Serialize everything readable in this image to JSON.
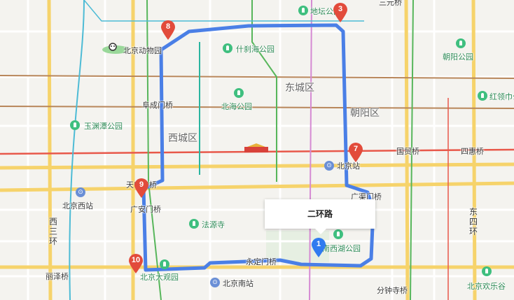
{
  "route": {
    "popup_label": "二环路",
    "color": "#4a7fe6"
  },
  "pins": [
    {
      "id": "1",
      "color": "#2f7bf0"
    },
    {
      "id": "3",
      "color": "#e24b3b"
    },
    {
      "id": "7",
      "color": "#e24b3b"
    },
    {
      "id": "8",
      "color": "#e24b3b"
    },
    {
      "id": "9",
      "color": "#e24b3b"
    },
    {
      "id": "10",
      "color": "#e24b3b"
    }
  ],
  "districts": {
    "dongcheng": "东城区",
    "xicheng": "西城区",
    "chaoyang": "朝阳区"
  },
  "pois": {
    "ditan": "地坛公园",
    "zoo": "北京动物园",
    "shichahai": "什刹海公园",
    "chaoyang_park": "朝阳公园",
    "beihai": "北海公园",
    "hongling": "红领巾公",
    "yuyuantan": "玉渊潭公园",
    "fayuan": "法源寺",
    "nanhu": "南西湖公园",
    "daguanyuan": "北京大观园",
    "huanlegu": "北京欢乐谷"
  },
  "places": {
    "fuchengmen": "阜成门桥",
    "guomao": "国贸桥",
    "sihui": "四惠桥",
    "tianning": "天宁寺桥",
    "guanganmen": "广安门桥",
    "yongdingmen": "永定门桥",
    "fenzhongsi": "分钟寺桥",
    "lize": "丽泽桥",
    "sanyuan": "三元桥",
    "guangqumen": "广渠门桥"
  },
  "stations": {
    "beijing": "北京站",
    "beijing_west": "北京西站",
    "beijing_south": "北京南站"
  },
  "roads": {
    "west3": "西三环",
    "east4": "东四环"
  }
}
